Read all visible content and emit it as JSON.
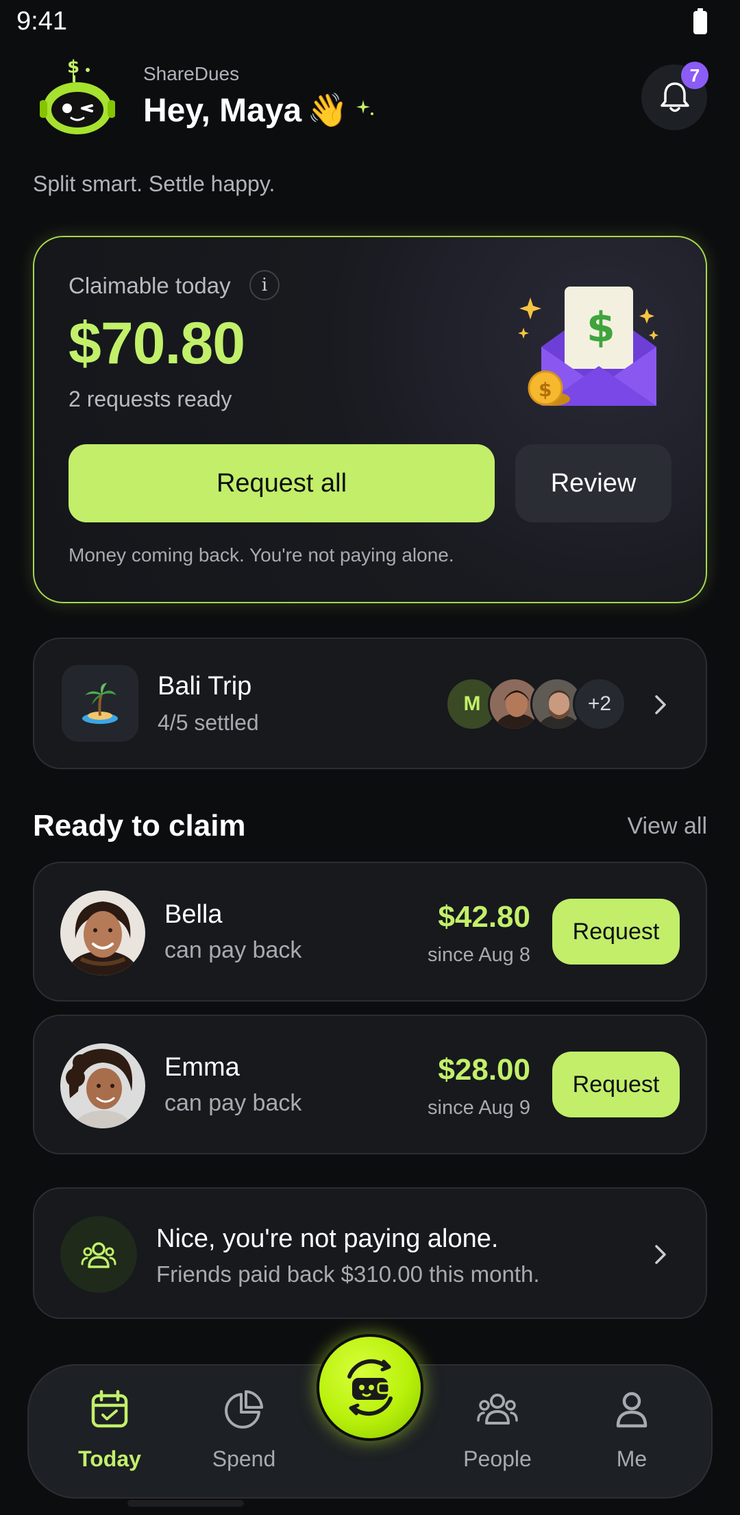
{
  "status_bar": {
    "time": "9:41"
  },
  "header": {
    "app_name": "ShareDues",
    "greeting": "Hey, Maya",
    "greeting_emoji": "👋",
    "notification_count": "7"
  },
  "tagline": "Split smart. Settle happy.",
  "claim_card": {
    "label": "Claimable today",
    "info_symbol": "i",
    "amount": "$70.80",
    "requests_ready": "2 requests ready",
    "request_all_label": "Request all",
    "review_label": "Review",
    "footer": "Money coming back. You're not paying alone."
  },
  "trip": {
    "name": "Bali Trip",
    "status": "4/5 settled",
    "avatar_initial": "M",
    "more_count": "+2"
  },
  "ready_section": {
    "title": "Ready to claim",
    "view_all": "View all",
    "items": [
      {
        "name": "Bella",
        "subtitle": "can pay back",
        "amount": "$42.80",
        "since": "since Aug 8",
        "action": "Request"
      },
      {
        "name": "Emma",
        "subtitle": "can pay back",
        "amount": "$28.00",
        "since": "since Aug 9",
        "action": "Request"
      }
    ]
  },
  "nice_card": {
    "title": "Nice, you're not paying alone.",
    "subtitle": "Friends paid back $310.00 this month."
  },
  "tab_bar": {
    "tabs": [
      {
        "label": "Today",
        "icon": "calendar-icon",
        "active": true
      },
      {
        "label": "Spend",
        "icon": "pie-chart-icon",
        "active": false
      },
      {
        "label": "People",
        "icon": "people-icon",
        "active": false
      },
      {
        "label": "Me",
        "icon": "user-icon",
        "active": false
      }
    ],
    "center_button_icon": "robot-wallet-icon"
  },
  "colors": {
    "accent": "#c2f06a",
    "background": "#0c0d0f",
    "card": "#17191d",
    "badge": "#8b5cf6"
  }
}
